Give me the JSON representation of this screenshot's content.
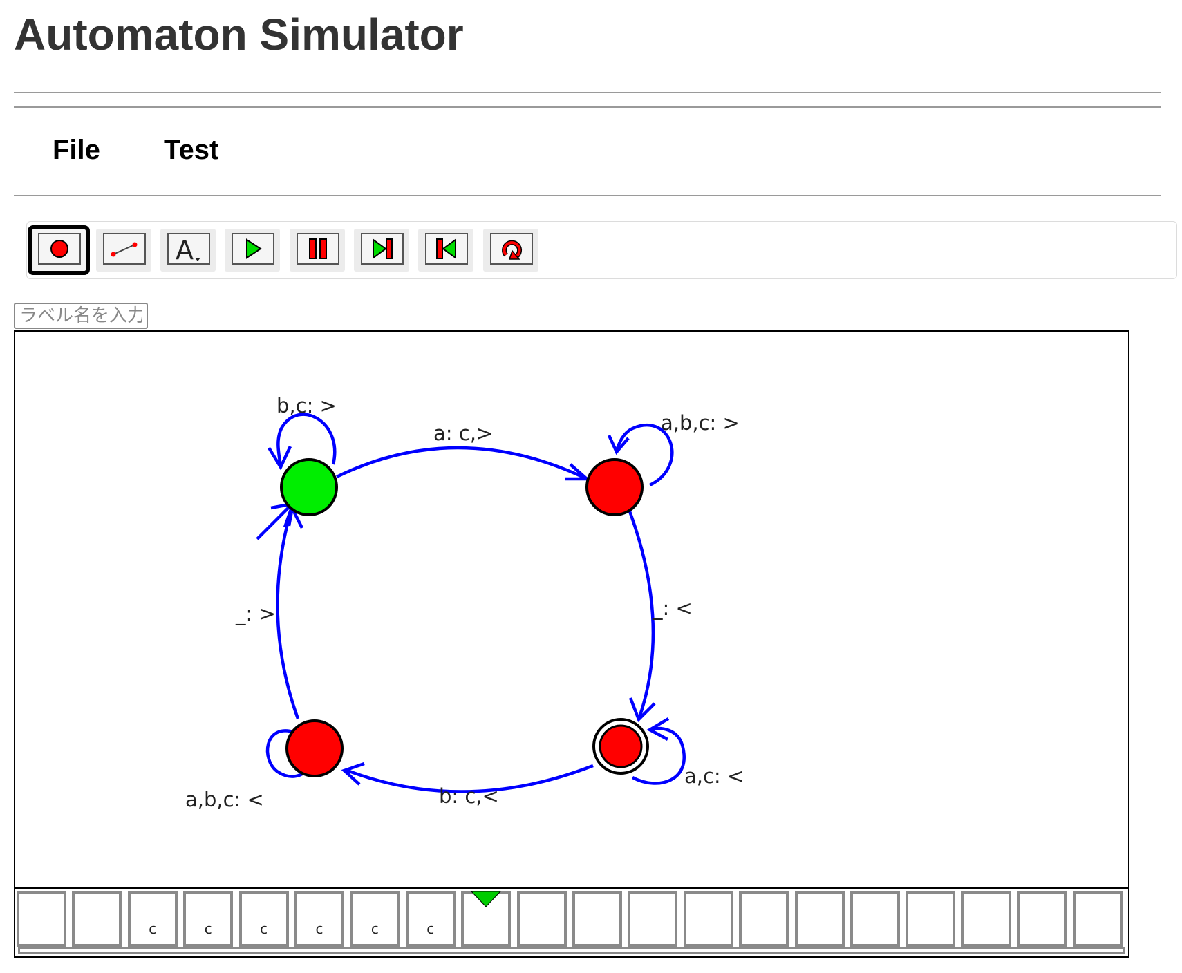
{
  "app": {
    "title": "Automaton Simulator"
  },
  "menu": {
    "items": [
      {
        "label": "File"
      },
      {
        "label": "Test"
      }
    ]
  },
  "toolbar": {
    "buttons": [
      {
        "name": "state-tool",
        "icon": "state-circle-icon",
        "active": true
      },
      {
        "name": "transition-tool",
        "icon": "transition-line-icon",
        "active": false
      },
      {
        "name": "text-tool",
        "icon": "text-a-icon",
        "active": false
      },
      {
        "name": "play",
        "icon": "play-icon",
        "active": false
      },
      {
        "name": "pause",
        "icon": "pause-icon",
        "active": false
      },
      {
        "name": "step-forward",
        "icon": "step-forward-icon",
        "active": false
      },
      {
        "name": "step-back",
        "icon": "step-back-icon",
        "active": false
      },
      {
        "name": "reset",
        "icon": "reset-icon",
        "active": false
      }
    ]
  },
  "label_input": {
    "placeholder": "ラベル名を入力",
    "value": ""
  },
  "diagram": {
    "states": [
      {
        "id": "q0",
        "color": "#00ee00",
        "initial": true,
        "accepting": false
      },
      {
        "id": "q1",
        "color": "#ff0000",
        "initial": false,
        "accepting": false
      },
      {
        "id": "q2",
        "color": "#ff0000",
        "initial": false,
        "accepting": true
      },
      {
        "id": "q3",
        "color": "#ff0000",
        "initial": false,
        "accepting": false
      }
    ],
    "transitions": [
      {
        "from": "q0",
        "to": "q0",
        "label": "b,c: >"
      },
      {
        "from": "q0",
        "to": "q1",
        "label": "a: c,>"
      },
      {
        "from": "q1",
        "to": "q1",
        "label": "a,b,c: >"
      },
      {
        "from": "q1",
        "to": "q2",
        "label": "_: <"
      },
      {
        "from": "q2",
        "to": "q2",
        "label": "a,c: <"
      },
      {
        "from": "q2",
        "to": "q3",
        "label": "b: c,<"
      },
      {
        "from": "q3",
        "to": "q3",
        "label": "a,b,c: <"
      },
      {
        "from": "q3",
        "to": "q0",
        "label": "_: >"
      }
    ],
    "edge_color": "#0000ff"
  },
  "tape": {
    "cells": [
      "",
      "",
      "c",
      "c",
      "c",
      "c",
      "c",
      "c",
      "",
      "",
      "",
      "",
      "",
      "",
      "",
      "",
      "",
      "",
      "",
      ""
    ],
    "head_index": 8,
    "head_color": "#00cc00"
  }
}
